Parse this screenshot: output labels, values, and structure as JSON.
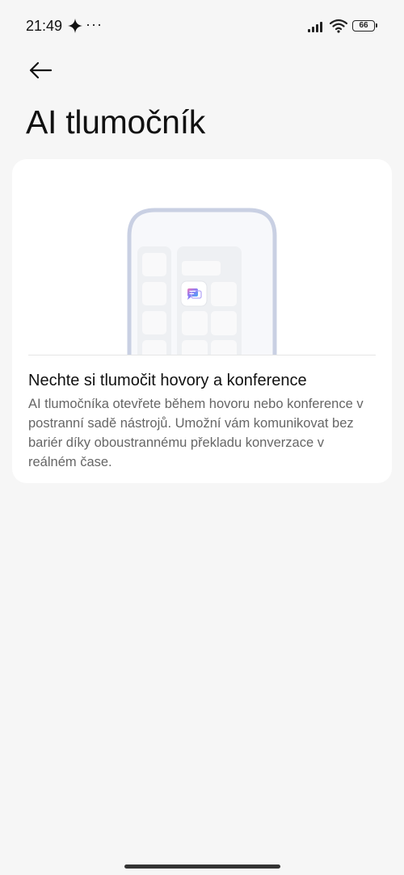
{
  "status_bar": {
    "time": "21:49",
    "overflow_indicator": "···",
    "battery": "66",
    "icons": [
      "sparkle-icon",
      "signal-icon",
      "wifi-icon",
      "battery-icon"
    ]
  },
  "nav": {
    "back_icon": "arrow-left-icon"
  },
  "page": {
    "title": "AI tlumočník"
  },
  "card": {
    "illustration": "phone-with-translator-icon",
    "heading": "Nechte si tlumočit hovory a konference",
    "description": "AI tlumočníka otevřete během hovoru nebo konference v postranní sadě nástrojů. Umožní vám komunikovat bez bariér díky oboustrannému překladu konverzace v reálném čase."
  },
  "colors": {
    "background": "#f6f6f6",
    "card": "#ffffff",
    "phone_frame": "#c9d0e3",
    "accent_gradient": [
      "#f07ab8",
      "#8a7cf6",
      "#4aa9f2"
    ]
  }
}
